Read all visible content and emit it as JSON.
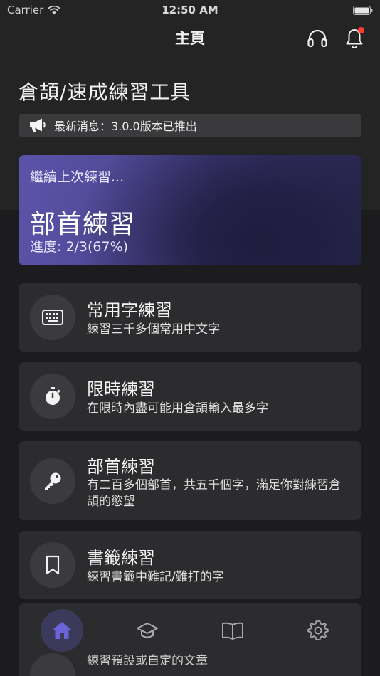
{
  "status_bar": {
    "carrier": "Carrier",
    "time": "12:50 AM"
  },
  "nav": {
    "title": "主頁"
  },
  "page_title": "倉頡/速成練習工具",
  "news": {
    "text": "最新消息：3.0.0版本已推出"
  },
  "continue_card": {
    "label": "繼續上次練習...",
    "title": "部首練習",
    "progress": "進度: 2/3(67%)"
  },
  "menu": [
    {
      "title": "常用字練習",
      "desc": "練習三千多個常用中文字",
      "icon": "keyboard-icon"
    },
    {
      "title": "限時練習",
      "desc": "在限時內盡可能用倉頡輸入最多字",
      "icon": "stopwatch-icon"
    },
    {
      "title": "部首練習",
      "desc": "有二百多個部首，共五千個字，滿足你對練習倉頡的慾望",
      "icon": "key-icon"
    },
    {
      "title": "書籤練習",
      "desc": "練習書籤中難記/難打的字",
      "icon": "bookmark-icon"
    }
  ],
  "peek_item": {
    "desc": "練習預設或自定的文章"
  },
  "tabs": [
    "home-icon",
    "graduation-cap-icon",
    "book-icon",
    "gear-icon"
  ],
  "colors": {
    "accent": "#6c63d9",
    "background": "#1c1c1e",
    "card": "#2c2c2e",
    "badge": "#ff3b30"
  }
}
